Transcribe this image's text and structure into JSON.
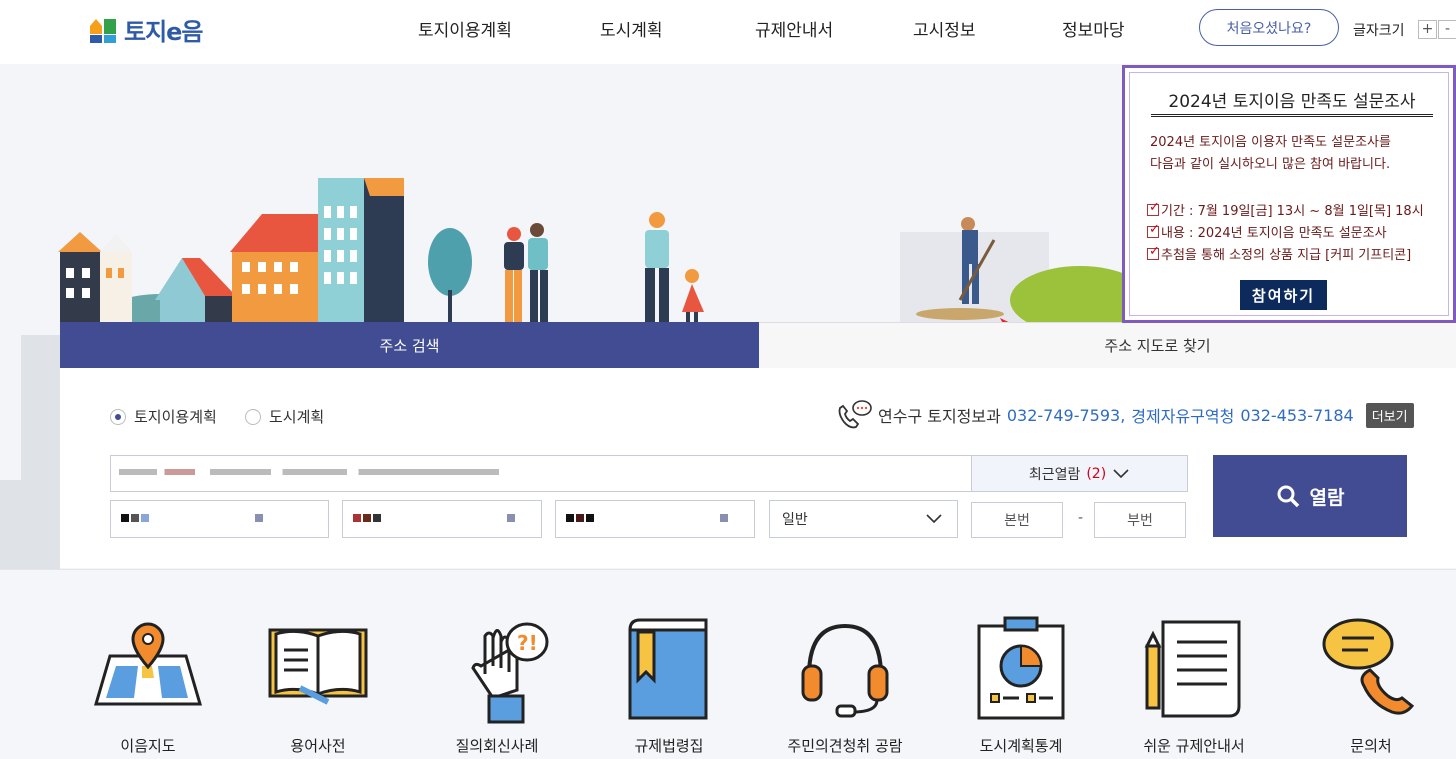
{
  "header": {
    "logo": "토지e음",
    "nav": [
      "토지이용계획",
      "도시계획",
      "규제안내서",
      "고시정보",
      "정보마당"
    ],
    "first_visit": "처음오셨나요?",
    "font_size_label": "글자크기",
    "font_plus": "+",
    "font_minus": "-"
  },
  "tabs": {
    "address_search": "주소 검색",
    "map_search": "주소 지도로 찾기"
  },
  "search": {
    "radio_land": "토지이용계획",
    "radio_city": "도시계획",
    "selected_radio": "토지이용계획",
    "contact_label": "연수구 토지정보과",
    "contact_num1": "032-749-7593,",
    "contact_label2": "경제자유구역청",
    "contact_num2": "032-453-7184",
    "more": "더보기",
    "recent_label": "최근열람",
    "recent_count": "(2)",
    "type_select": "일반",
    "main_no": "본번",
    "dash": "-",
    "sub_no": "부번",
    "view_button": "열람"
  },
  "popup": {
    "title": "2024년 토지이음 만족도 설문조사",
    "line1": "2024년 토지이음 이용자 만족도 설문조사를",
    "line2": "다음과 같이 실시하오니 많은 참여 바랍니다.",
    "period": "기간 : 7월 19일[금] 13시 ~ 8월 1일[목] 18시",
    "content": "내용 : 2024년 토지이음 만족도 설문조사",
    "prize": "추첨을 통해 소정의 상품 지급 [커피 기프티콘]",
    "join": "참여하기"
  },
  "quick_menu": [
    "이음지도",
    "용어사전",
    "질의회신사례",
    "규제법령집",
    "주민의견청취 공람",
    "도시계획통계",
    "쉬운 규제안내서",
    "문의처"
  ],
  "colors": {
    "primary": "#424c92",
    "link_blue": "#2f6bc6",
    "popup_border": "#7d5bbf"
  }
}
